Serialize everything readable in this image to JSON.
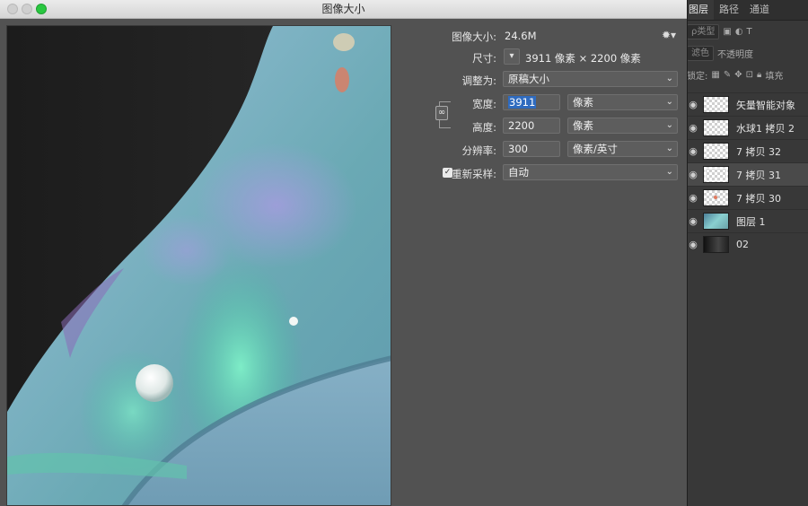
{
  "dialog": {
    "title": "图像大小",
    "image_size_label": "图像大小:",
    "image_size_value": "24.6M",
    "dimensions_label": "尺寸:",
    "dimensions_value": "3911 像素  ×  2200 像素",
    "fit_to_label": "调整为:",
    "fit_to_value": "原稿大小",
    "width_label": "宽度:",
    "width_value": "3911",
    "width_unit": "像素",
    "height_label": "高度:",
    "height_value": "2200",
    "height_unit": "像素",
    "resolution_label": "分辨率:",
    "resolution_value": "300",
    "resolution_unit": "像素/英寸",
    "resample_label": "重新采样:",
    "resample_checked": true,
    "resample_value": "自动"
  },
  "layers_panel": {
    "tabs": [
      "图层",
      "路径",
      "通道"
    ],
    "active_tab": "图层",
    "filter_kind": "ρ类型",
    "blend_mode": "滤色",
    "opacity_label": "不透明度",
    "lock_label": "锁定:",
    "fill_label": "填充",
    "layers": [
      {
        "name": "矢量智能对象",
        "thumb": "checker",
        "selected": false
      },
      {
        "name": "水球1 拷贝 2",
        "thumb": "checker",
        "selected": false
      },
      {
        "name": "7 拷贝 32",
        "thumb": "checker",
        "selected": false
      },
      {
        "name": "7 拷贝 31",
        "thumb": "checker",
        "selected": true
      },
      {
        "name": "7 拷贝 30",
        "thumb": "checker-dot",
        "selected": false
      },
      {
        "name": "图层 1",
        "thumb": "water",
        "selected": false
      },
      {
        "name": "02",
        "thumb": "dark",
        "selected": false
      }
    ]
  },
  "icons": {
    "gear": "gear-icon",
    "link": "link-chain-icon",
    "chevron": "chevron-down-icon",
    "eye": "eye-icon"
  },
  "colors": {
    "dialog_bg": "#525252",
    "panel_bg": "#383838",
    "selection": "#2f6bbf",
    "zoom_light": "#29c740"
  }
}
